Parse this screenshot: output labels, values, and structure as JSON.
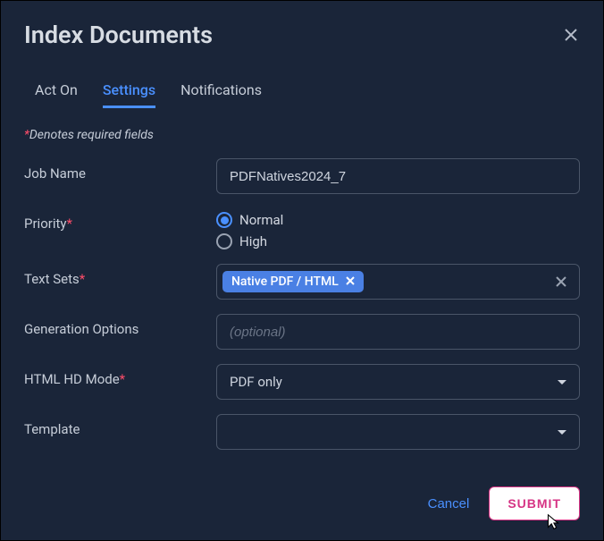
{
  "header": {
    "title": "Index Documents"
  },
  "tabs": {
    "items": [
      "Act On",
      "Settings",
      "Notifications"
    ],
    "active": "Settings"
  },
  "required_note": {
    "asterisk": "*",
    "text": "Denotes required fields"
  },
  "form": {
    "job_name": {
      "label": "Job Name",
      "value": "PDFNatives2024_7"
    },
    "priority": {
      "label": "Priority",
      "options": [
        "Normal",
        "High"
      ],
      "selected": "Normal"
    },
    "text_sets": {
      "label": "Text Sets",
      "tags": [
        "Native PDF / HTML"
      ]
    },
    "generation_options": {
      "label": "Generation Options",
      "placeholder": "(optional)",
      "value": ""
    },
    "html_hd_mode": {
      "label": "HTML HD Mode",
      "value": "PDF only"
    },
    "template": {
      "label": "Template",
      "value": ""
    }
  },
  "footer": {
    "cancel": "Cancel",
    "submit": "SUBMIT"
  }
}
